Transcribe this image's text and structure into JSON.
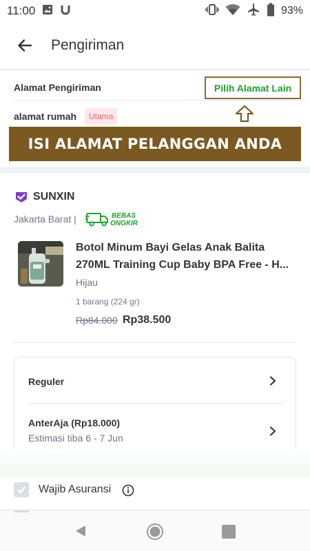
{
  "status_bar": {
    "time": "11:00",
    "battery_percent": "93%",
    "icons_left": [
      "image-icon",
      "u-app-icon"
    ],
    "icons_right": [
      "vibrate-icon",
      "wifi-icon",
      "airplane-icon",
      "battery-icon"
    ]
  },
  "app_bar": {
    "title": "Pengiriman",
    "back_icon": "arrow-left-icon"
  },
  "address": {
    "label": "Alamat Pengiriman",
    "change_button": "Pilih Alamat Lain",
    "name": "alamat rumah",
    "badge": "Utama",
    "banner": "ISI ALAMAT PELANGGAN ANDA"
  },
  "shop": {
    "name": "SUNXIN",
    "location": "Jakarta Barat |",
    "free_shipping_top": "BEBAS",
    "free_shipping_bottom": "ONGKIR"
  },
  "product": {
    "title": "Botol Minum Bayi Gelas Anak Balita 270ML Training Cup Baby BPA Free - H...",
    "variant": "Hijau",
    "quantity": "1 barang (224 gr)",
    "price_original": "Rp84.000",
    "price_final": "Rp38.500"
  },
  "shipping": {
    "service": "Reguler",
    "courier": "AnterAja (Rp18.000)",
    "eta": "Estimasi tiba 6 - 7 Jun"
  },
  "insurance": {
    "label": "Wajib Asuransi",
    "checked": true
  },
  "colors": {
    "accent_green": "#1fa02f",
    "banner_brown": "#7a5a22",
    "badge_pink": "#ef5b74",
    "shop_badge_purple": "#7b3fc4"
  }
}
